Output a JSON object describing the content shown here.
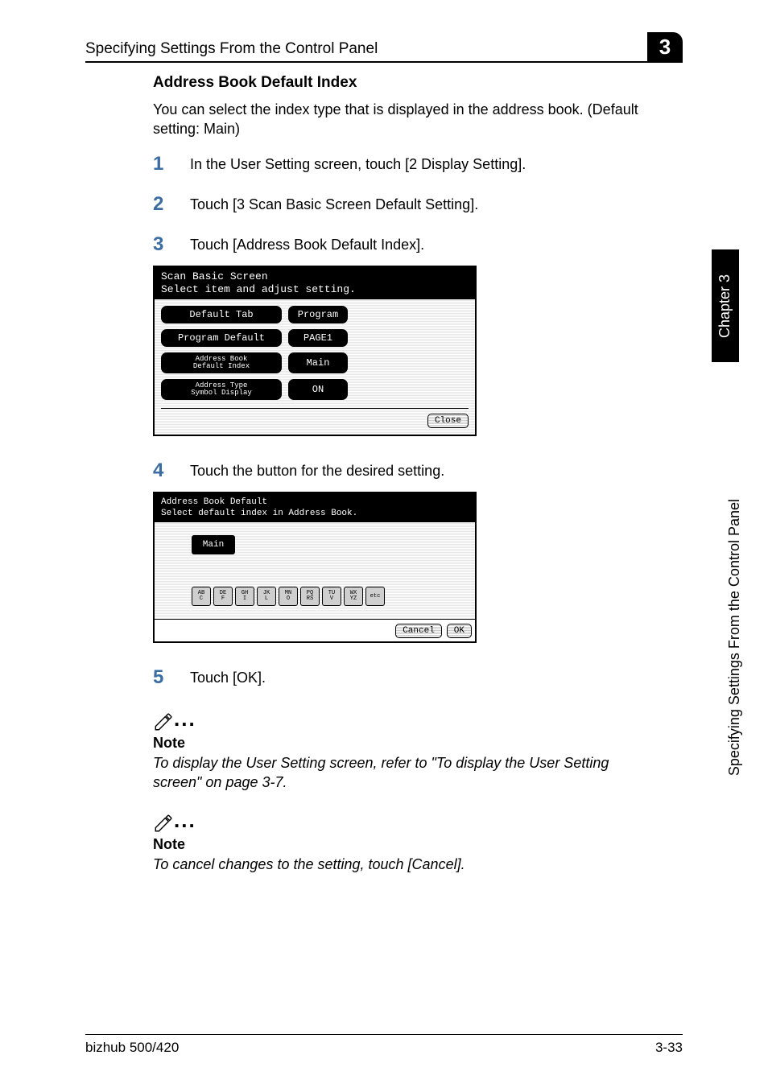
{
  "header": {
    "title": "Specifying Settings From the Control Panel",
    "chapter_number": "3"
  },
  "sidebar": {
    "chapter_label": "Chapter 3",
    "section_label": "Specifying Settings From the Control Panel"
  },
  "section": {
    "title": "Address Book Default Index",
    "intro": "You can select the index type that is displayed in the address book. (Default setting: Main)"
  },
  "steps": [
    {
      "num": "1",
      "text": "In the User Setting screen, touch [2 Display Setting]."
    },
    {
      "num": "2",
      "text": "Touch [3 Scan Basic Screen Default Setting]."
    },
    {
      "num": "3",
      "text": "Touch [Address Book Default Index]."
    },
    {
      "num": "4",
      "text": "Touch the button for the desired setting."
    },
    {
      "num": "5",
      "text": "Touch [OK]."
    }
  ],
  "screen1": {
    "title_line1": "Scan Basic Screen",
    "title_line2": "Select item and adjust setting.",
    "rows": [
      {
        "label": "Default Tab",
        "value": "Program"
      },
      {
        "label": "Program Default",
        "value": "PAGE1"
      },
      {
        "label_line1": "Address Book",
        "label_line2": "Default Index",
        "value": "Main"
      },
      {
        "label_line1": "Address Type",
        "label_line2": "Symbol Display",
        "value": "ON"
      }
    ],
    "close_label": "Close"
  },
  "screen2": {
    "title_line1": "Address Book Default",
    "title_line2": "Select default index in Address Book.",
    "main_label": "Main",
    "tabs": [
      {
        "l1": "AB",
        "l2": "C"
      },
      {
        "l1": "DE",
        "l2": "F"
      },
      {
        "l1": "GH",
        "l2": "I"
      },
      {
        "l1": "JK",
        "l2": "L"
      },
      {
        "l1": "MN",
        "l2": "O"
      },
      {
        "l1": "PQ",
        "l2": "RS"
      },
      {
        "l1": "TU",
        "l2": "V"
      },
      {
        "l1": "WX",
        "l2": "YZ"
      },
      {
        "l1": " ",
        "l2": "etc"
      }
    ],
    "cancel_label": "Cancel",
    "ok_label": "OK"
  },
  "notes": [
    {
      "heading": "Note",
      "text": "To display the User Setting screen, refer to \"To display the User Setting screen\" on page 3-7."
    },
    {
      "heading": "Note",
      "text": "To cancel changes to the setting, touch [Cancel]."
    }
  ],
  "footer": {
    "left": "bizhub 500/420",
    "right": "3-33"
  }
}
